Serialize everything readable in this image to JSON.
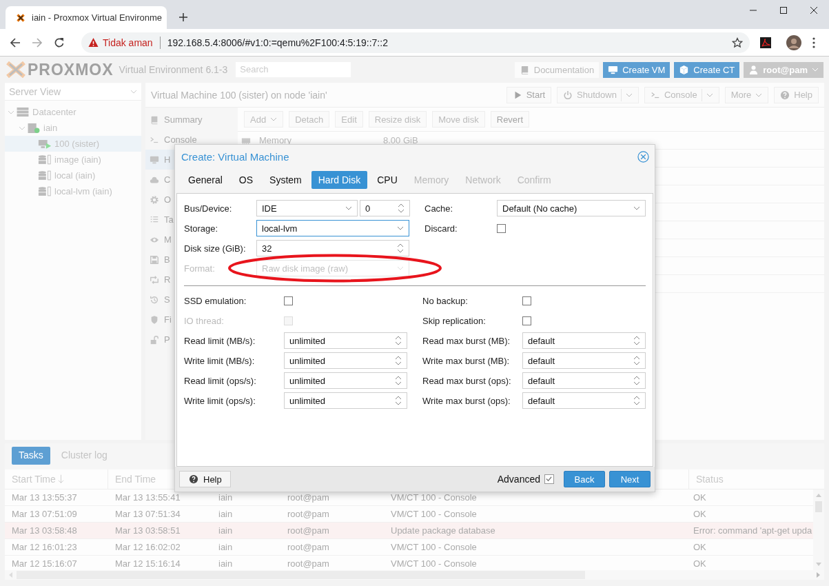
{
  "browser": {
    "tab_title": "iain - Proxmox Virtual Environme",
    "security": "Tidak aman",
    "url": "192.168.5.4:8006/#v1:0:=qemu%2F100:4:5:19::7::2"
  },
  "header": {
    "logo": "PROXMOX",
    "product": "Virtual Environment 6.1-3",
    "search_placeholder": "Search",
    "buttons": [
      {
        "label": "Documentation",
        "kind": "plain"
      },
      {
        "label": "Create VM",
        "kind": "primary"
      },
      {
        "label": "Create CT",
        "kind": "primary"
      },
      {
        "label": "root@pam",
        "kind": "user"
      }
    ]
  },
  "server_view": {
    "label": "Server View",
    "tree": [
      {
        "label": "Datacenter",
        "kind": "datacenter",
        "expanded": true,
        "selected": false,
        "children": [
          {
            "label": "iain",
            "kind": "node",
            "expanded": true,
            "selected": false,
            "children": [
              {
                "label": "100 (sister)",
                "kind": "vm",
                "selected": true
              },
              {
                "label": "image (iain)",
                "kind": "storage",
                "selected": false
              },
              {
                "label": "local (iain)",
                "kind": "storage",
                "selected": false
              },
              {
                "label": "local-lvm (iain)",
                "kind": "storage",
                "selected": false
              }
            ]
          }
        ]
      }
    ]
  },
  "content": {
    "title": "Virtual Machine 100 (sister) on node 'iain'",
    "actions": [
      {
        "label": "Start",
        "disabled": true,
        "split": false,
        "menu": false
      },
      {
        "label": "Shutdown",
        "disabled": false,
        "split": true,
        "menu": true
      },
      {
        "label": "Console",
        "disabled": false,
        "split": true,
        "menu": true
      },
      {
        "label": "More",
        "disabled": false,
        "split": false,
        "menu": true
      },
      {
        "label": "Help",
        "disabled": false,
        "split": false,
        "menu": false
      }
    ]
  },
  "menu": [
    {
      "label": "Summary",
      "selected": false
    },
    {
      "label": "Console",
      "selected": false
    },
    {
      "label": "H",
      "selected": true
    },
    {
      "label": "C",
      "selected": false
    },
    {
      "label": "O",
      "selected": false
    },
    {
      "label": "Ta",
      "selected": false
    },
    {
      "label": "M",
      "selected": false
    },
    {
      "label": "B",
      "selected": false
    },
    {
      "label": "R",
      "selected": false
    },
    {
      "label": "S",
      "selected": false
    },
    {
      "label": "Fi",
      "selected": false
    },
    {
      "label": "P",
      "selected": false
    }
  ],
  "hardware": {
    "toolbar": [
      {
        "label": "Add",
        "disabled": false,
        "menu": true
      },
      {
        "label": "Detach",
        "disabled": false,
        "menu": false
      },
      {
        "label": "Edit",
        "disabled": false,
        "menu": false
      },
      {
        "label": "Resize disk",
        "disabled": false,
        "menu": false
      },
      {
        "label": "Move disk",
        "disabled": false,
        "menu": false
      },
      {
        "label": "Revert",
        "disabled": true,
        "menu": false
      }
    ],
    "rows": [
      {
        "name": "Memory",
        "value": "8.00 GiB"
      }
    ]
  },
  "tasks": {
    "tabs": [
      {
        "label": "Tasks",
        "selected": true
      },
      {
        "label": "Cluster log",
        "selected": false
      }
    ],
    "columns": [
      {
        "label": "Start Time",
        "sorted": true
      },
      {
        "label": "End Time",
        "sorted": false
      },
      {
        "label": "Status",
        "sorted": false
      }
    ],
    "rows": [
      {
        "start": "Mar 13 13:55:37",
        "end": "Mar 13 13:55:41",
        "node": "iain",
        "user": "root@pam",
        "description": "VM/CT 100 - Console",
        "status": "OK",
        "error": false
      },
      {
        "start": "Mar 13 07:51:09",
        "end": "Mar 13 07:51:34",
        "node": "iain",
        "user": "root@pam",
        "description": "VM/CT 100 - Console",
        "status": "OK",
        "error": false
      },
      {
        "start": "Mar 13 03:58:48",
        "end": "Mar 13 03:58:51",
        "node": "iain",
        "user": "root@pam",
        "description": "Update package database",
        "status": "Error: command 'apt-get upda",
        "error": true
      },
      {
        "start": "Mar 12 16:01:23",
        "end": "Mar 12 16:02:02",
        "node": "iain",
        "user": "root@pam",
        "description": "VM/CT 100 - Console",
        "status": "OK",
        "error": false
      },
      {
        "start": "Mar 12 15:16:07",
        "end": "Mar 12 15:16:14",
        "node": "iain",
        "user": "root@pam",
        "description": "VM/CT 100 - Console",
        "status": "OK",
        "error": false
      }
    ]
  },
  "dialog": {
    "title": "Create: Virtual Machine",
    "tabs": [
      {
        "label": "General",
        "selected": false,
        "disabled": false
      },
      {
        "label": "OS",
        "selected": false,
        "disabled": false
      },
      {
        "label": "System",
        "selected": false,
        "disabled": false
      },
      {
        "label": "Hard Disk",
        "selected": true,
        "disabled": false
      },
      {
        "label": "CPU",
        "selected": false,
        "disabled": false
      },
      {
        "label": "Memory",
        "selected": false,
        "disabled": true
      },
      {
        "label": "Network",
        "selected": false,
        "disabled": true
      },
      {
        "label": "Confirm",
        "selected": false,
        "disabled": true
      }
    ],
    "top_left": [
      {
        "label": "Bus/Device:",
        "kind": "pair",
        "value": "IDE",
        "number": "0",
        "disabled": false,
        "focused": false,
        "circled": false
      },
      {
        "label": "Storage:",
        "kind": "select",
        "value": "local-lvm",
        "disabled": false,
        "focused": true,
        "circled": false
      },
      {
        "label": "Disk size (GiB):",
        "kind": "spinner",
        "value": "32",
        "disabled": false,
        "focused": false,
        "circled": false
      },
      {
        "label": "Format:",
        "kind": "select",
        "value": "Raw disk image (raw)",
        "disabled": true,
        "focused": false,
        "circled": true
      }
    ],
    "top_right": [
      {
        "label": "Cache:",
        "kind": "select",
        "value": "Default (No cache)",
        "disabled": false,
        "focused": false,
        "circled": false
      },
      {
        "label": "Discard:",
        "kind": "checkbox",
        "checked": false,
        "disabled": false
      }
    ],
    "bottom_left": [
      {
        "label": "SSD emulation:",
        "kind": "checkbox",
        "checked": false,
        "disabled": false
      },
      {
        "label": "IO thread:",
        "kind": "checkbox",
        "checked": false,
        "disabled": true
      },
      {
        "label": "Read limit (MB/s):",
        "kind": "spinner",
        "value": "unlimited",
        "disabled": false,
        "focused": false,
        "circled": false
      },
      {
        "label": "Write limit (MB/s):",
        "kind": "spinner",
        "value": "unlimited",
        "disabled": false,
        "focused": false,
        "circled": false
      },
      {
        "label": "Read limit (ops/s):",
        "kind": "spinner",
        "value": "unlimited",
        "disabled": false,
        "focused": false,
        "circled": false
      },
      {
        "label": "Write limit (ops/s):",
        "kind": "spinner",
        "value": "unlimited",
        "disabled": false,
        "focused": false,
        "circled": false
      }
    ],
    "bottom_right": [
      {
        "label": "No backup:",
        "kind": "checkbox",
        "checked": false,
        "disabled": false
      },
      {
        "label": "Skip replication:",
        "kind": "checkbox",
        "checked": false,
        "disabled": false
      },
      {
        "label": "Read max burst (MB):",
        "kind": "spinner",
        "value": "default",
        "disabled": false,
        "focused": false,
        "circled": false
      },
      {
        "label": "Write max burst (MB):",
        "kind": "spinner",
        "value": "default",
        "disabled": false,
        "focused": false,
        "circled": false
      },
      {
        "label": "Read max burst (ops):",
        "kind": "spinner",
        "value": "default",
        "disabled": false,
        "focused": false,
        "circled": false
      },
      {
        "label": "Write max burst (ops):",
        "kind": "spinner",
        "value": "default",
        "disabled": false,
        "focused": false,
        "circled": false
      }
    ],
    "help": "Help",
    "advanced": {
      "label": "Advanced",
      "checked": true
    },
    "buttons": [
      {
        "label": "Back"
      },
      {
        "label": "Next"
      }
    ]
  }
}
